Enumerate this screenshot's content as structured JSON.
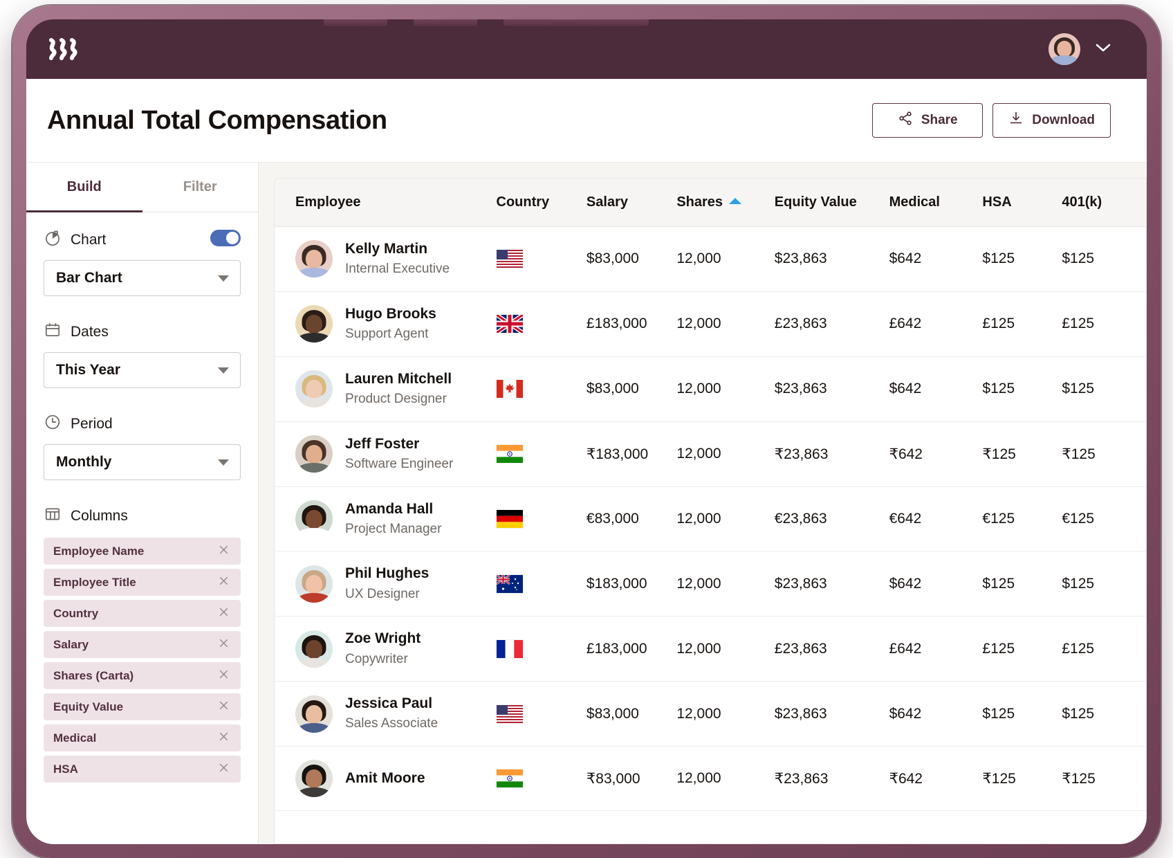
{
  "app": {
    "logo_icon": "three-wave-strokes-logo",
    "chevron_icon": "chevron-down-icon",
    "avatar_name": "user-avatar"
  },
  "page": {
    "title": "Annual Total Compensation",
    "actions": [
      {
        "label": "Share",
        "icon": "share-nodes-icon"
      },
      {
        "label": "Download",
        "icon": "download-icon"
      }
    ]
  },
  "sidebar": {
    "tabs": [
      {
        "label": "Build",
        "active": true
      },
      {
        "label": "Filter",
        "active": false
      }
    ],
    "sections": [
      {
        "icon": "pie-chart-icon",
        "label": "Chart",
        "toggle": true,
        "value": "Bar Chart"
      },
      {
        "icon": "calendar-icon",
        "label": "Dates",
        "toggle": false,
        "value": "This Year"
      },
      {
        "icon": "clock-icon",
        "label": "Period",
        "toggle": false,
        "value": "Monthly"
      }
    ],
    "columns_label": "Columns",
    "columns_icon": "table-columns-icon",
    "columns": [
      "Employee Name",
      "Employee Title",
      "Country",
      "Salary",
      "Shares (Carta)",
      "Equity Value",
      "Medical",
      "HSA"
    ],
    "remove_icon": "close-x-icon"
  },
  "table": {
    "headers": [
      "Employee",
      "Country",
      "Salary",
      "Shares",
      "Equity Value",
      "Medical",
      "HSA",
      "401(k)"
    ],
    "sort": {
      "column": "Shares",
      "direction": "asc",
      "color": "#2b9fe8"
    },
    "rows": [
      {
        "name": "Kelly Martin",
        "title": "Internal Executive",
        "country": "us",
        "salary": "$83,000",
        "shares": "12,000",
        "equity": "$23,863",
        "medical": "$642",
        "hsa": "$125",
        "k401": "$125",
        "avatar": {
          "bg": "#e8cfc7",
          "hair": "#3b2a24",
          "skin": "#e8b8a0",
          "shirt": "#a9b8dd"
        }
      },
      {
        "name": "Hugo Brooks",
        "title": "Support Agent",
        "country": "gb",
        "salary": "£183,000",
        "shares": "12,000",
        "equity": "£23,863",
        "medical": "£642",
        "hsa": "£125",
        "k401": "£125",
        "avatar": {
          "bg": "#ead9b4",
          "hair": "#2a1d17",
          "skin": "#6b4430",
          "shirt": "#2c2c2c"
        }
      },
      {
        "name": "Lauren Mitchell",
        "title": "Product Designer",
        "country": "ca",
        "salary": "$83,000",
        "shares": "12,000",
        "equity": "$23,863",
        "medical": "$642",
        "hsa": "$125",
        "k401": "$125",
        "avatar": {
          "bg": "#dfe6ea",
          "hair": "#d9b97e",
          "skin": "#f0cbb4",
          "shirt": "#e7e3de"
        }
      },
      {
        "name": "Jeff Foster",
        "title": "Software Engineer",
        "country": "in",
        "salary": "₹183,000",
        "shares": "12,000",
        "equity": "₹23,863",
        "medical": "₹642",
        "hsa": "₹125",
        "k401": "₹125",
        "avatar": {
          "bg": "#d9cfc4",
          "hair": "#4a3226",
          "skin": "#e0ad8d",
          "shirt": "#6a6f6a"
        }
      },
      {
        "name": "Amanda Hall",
        "title": "Project Manager",
        "country": "de",
        "salary": "€83,000",
        "shares": "12,000",
        "equity": "€23,863",
        "medical": "€642",
        "hsa": "€125",
        "k401": "€125",
        "avatar": {
          "bg": "#cfd9d0",
          "hair": "#20150f",
          "skin": "#7a4a30",
          "shirt": "#ffffff"
        }
      },
      {
        "name": "Phil Hughes",
        "title": "UX Designer",
        "country": "au",
        "salary": "$183,000",
        "shares": "12,000",
        "equity": "$23,863",
        "medical": "$642",
        "hsa": "$125",
        "k401": "$125",
        "avatar": {
          "bg": "#dde6e6",
          "hair": "#c9a887",
          "skin": "#f0c2a8",
          "shirt": "#bc3b2a"
        }
      },
      {
        "name": "Zoe Wright",
        "title": "Copywriter",
        "country": "fr",
        "salary": "£183,000",
        "shares": "12,000",
        "equity": "£23,863",
        "medical": "£642",
        "hsa": "£125",
        "k401": "£125",
        "avatar": {
          "bg": "#d8e8e6",
          "hair": "#1d130e",
          "skin": "#6d432c",
          "shirt": "#e8e4e0"
        }
      },
      {
        "name": "Jessica Paul",
        "title": "Sales Associate",
        "country": "us",
        "salary": "$83,000",
        "shares": "12,000",
        "equity": "$23,863",
        "medical": "$642",
        "hsa": "$125",
        "k401": "$125",
        "avatar": {
          "bg": "#e4e0da",
          "hair": "#241811",
          "skin": "#e8bda0",
          "shirt": "#4c5f8a"
        }
      },
      {
        "name": "Amit Moore",
        "title": "",
        "country": "in",
        "salary": "₹83,000",
        "shares": "12,000",
        "equity": "₹23,863",
        "medical": "₹642",
        "hsa": "₹125",
        "k401": "₹125",
        "avatar": {
          "bg": "#dfe3dc",
          "hair": "#171210",
          "skin": "#b0795a",
          "shirt": "#3d3a38"
        }
      }
    ]
  },
  "colors": {
    "brand_maroon": "#4c2b3a",
    "chip_bg": "#efe2e7",
    "toggle_on": "#4a6db5",
    "sort_blue": "#2b9fe8",
    "canvas": "#f7f5f1"
  }
}
